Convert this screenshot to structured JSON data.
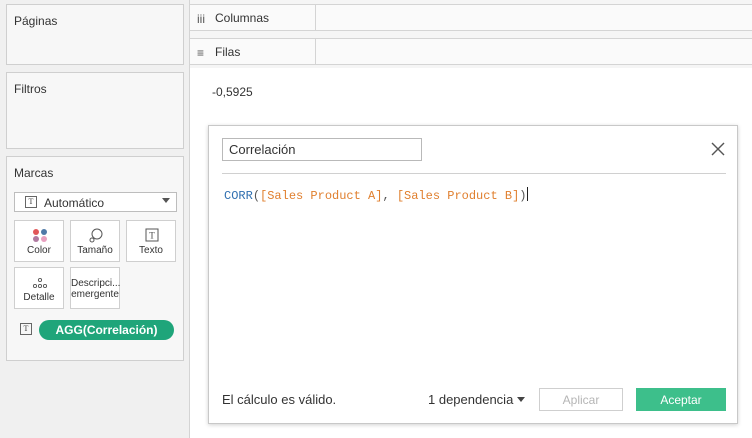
{
  "left_panel": {
    "pages_title": "Páginas",
    "filters_title": "Filtros",
    "marks_title": "Marcas",
    "mark_type": {
      "label": "Automático",
      "icon": "T"
    },
    "mark_buttons": [
      {
        "label": "Color",
        "icon": "color-dots-icon"
      },
      {
        "label": "Tamaño",
        "icon": "size-icon"
      },
      {
        "label": "Texto",
        "icon": "text-icon",
        "glyph": "T"
      },
      {
        "label": "Detalle",
        "icon": "detail-dots-icon"
      },
      {
        "label": "Descripci... emergente",
        "label_line1": "Descripci...",
        "label_line2": "emergente",
        "icon": "tooltip-icon"
      }
    ],
    "pill": {
      "type_icon": "T",
      "label": "AGG(Correlación)",
      "color": "#1fa57a"
    }
  },
  "shelves": {
    "columns": {
      "icon": "iii",
      "label": "Columnas"
    },
    "rows": {
      "icon": "≡",
      "label": "Filas"
    }
  },
  "view": {
    "value": "-0,5925"
  },
  "dialog": {
    "name_value": "Correlación",
    "formula": {
      "function": "CORR",
      "open": "(",
      "field1": "[Sales Product A]",
      "sep": ", ",
      "field2": "[Sales Product B]",
      "close": ")"
    },
    "status": "El cálculo es válido.",
    "dependency": "1 dependencia",
    "apply_label": "Aplicar",
    "ok_label": "Aceptar",
    "colors": {
      "function": "#2f6fb0",
      "field": "#e07f2e",
      "ok": "#3dbf8b"
    }
  }
}
